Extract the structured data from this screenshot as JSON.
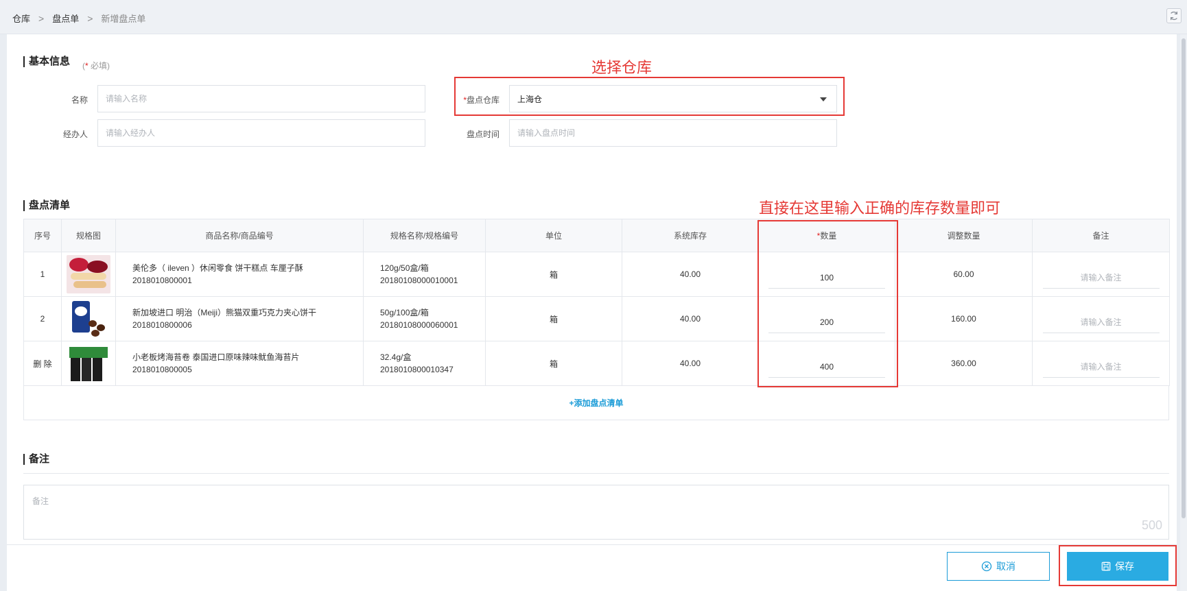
{
  "breadcrumb": {
    "items": [
      "仓库",
      "盘点单"
    ],
    "current": "新增盘点单"
  },
  "basic_info": {
    "title": "基本信息",
    "required_hint": "必填",
    "name_label": "名称",
    "name_placeholder": "请输入名称",
    "handler_label": "经办人",
    "handler_placeholder": "请输入经办人",
    "warehouse_label": "盘点仓库",
    "warehouse_value": "上海仓",
    "time_label": "盘点时间",
    "time_placeholder": "请输入盘点时间"
  },
  "annotations": {
    "warehouse_note": "选择仓库",
    "quantity_note": "直接在这里输入正确的库存数量即可"
  },
  "inventory": {
    "title": "盘点清单",
    "columns": [
      "序号",
      "规格图",
      "商品名称/商品编号",
      "规格名称/规格编号",
      "单位",
      "系统库存",
      "数量",
      "调整数量",
      "备注"
    ],
    "rows": [
      {
        "index": "1",
        "name": "美伦多（ ileven ）休闲零食 饼干糕点 车厘子酥",
        "code": "2018010800001",
        "spec": "120g/50盒/箱",
        "spec_code": "20180108000010001",
        "unit": "箱",
        "system_stock": "40.00",
        "quantity": "100",
        "adjust": "60.00",
        "remark_placeholder": "请输入备注"
      },
      {
        "index": "2",
        "name": "新加坡进口 明治（Meiji）熊猫双重巧克力夹心饼干",
        "code": "2018010800006",
        "spec": "50g/100盒/箱",
        "spec_code": "20180108000060001",
        "unit": "箱",
        "system_stock": "40.00",
        "quantity": "200",
        "adjust": "160.00",
        "remark_placeholder": "请输入备注"
      },
      {
        "index": "删 除",
        "name": "小老板烤海苔卷 泰国进口原味辣味鱿鱼海苔片",
        "code": "2018010800005",
        "spec": "32.4g/盒",
        "spec_code": "2018010800010347",
        "unit": "箱",
        "system_stock": "40.00",
        "quantity": "400",
        "adjust": "360.00",
        "remark_placeholder": "请输入备注"
      }
    ],
    "add_label": "+添加盘点清单"
  },
  "remark": {
    "title": "备注",
    "placeholder": "备注",
    "counter": "500"
  },
  "footer": {
    "cancel_label": "取消",
    "save_label": "保存"
  },
  "colors": {
    "accent": "#2aabe2",
    "annotation": "#e53935",
    "required": "#e02020"
  },
  "icons": {
    "refresh": "refresh-icon",
    "cancel": "close-circle-icon",
    "save": "save-icon",
    "dropdown": "caret-down-icon"
  }
}
